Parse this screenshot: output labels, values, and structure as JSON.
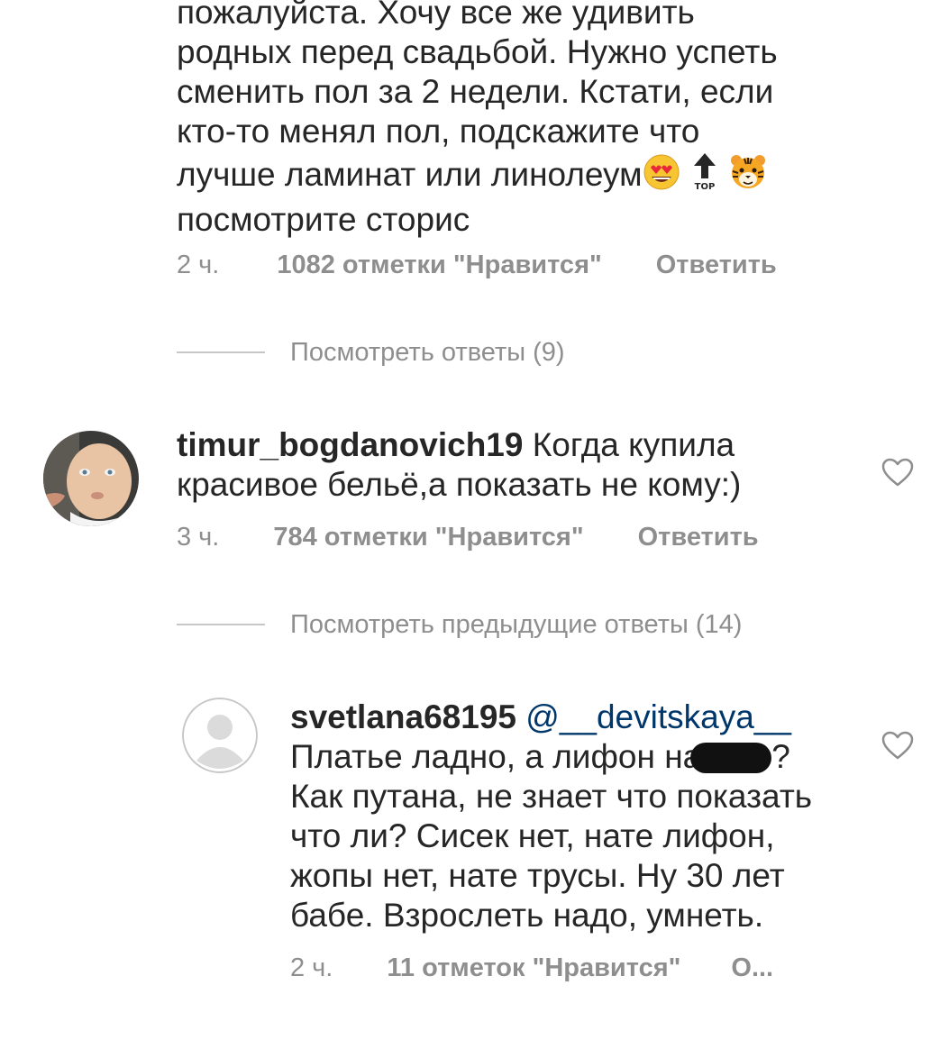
{
  "comment1": {
    "text_before_emoji": "пожалуйста. Хочу все же удивить\nродных перед свадьбой. Нужно успеть\nсменить пол за 2 недели. Кстати, если\nкто-то менял пол, подскажите что\nлучше ламинат или линолеум",
    "text_after_emoji": "посмотрите сторис",
    "emojis": [
      "heart-eyes-emoji",
      "top-arrow-emoji",
      "tiger-face-emoji"
    ],
    "top_label": "TOP",
    "time": "2 ч.",
    "likes": "1082 отметки \"Нравится\"",
    "reply": "Ответить"
  },
  "view_replies_1": {
    "label": "Посмотреть ответы (9)"
  },
  "comment2": {
    "username": "timur_bogdanovich19",
    "text": " Когда купила\nкрасивое бельё,а показать не кому:)",
    "time": "3 ч.",
    "likes": "784 отметки \"Нравится\"",
    "reply": "Ответить"
  },
  "view_replies_2": {
    "label": "Посмотреть предыдущие ответы (14)"
  },
  "comment3": {
    "username": "svetlana68195",
    "mention": " @__devitskaya__",
    "text_line1_before": "Платье ладно, а лифон на",
    "text_line1_after": "?",
    "text_rest": "Как путана, не знает что показать\nчто ли? Сисек нет, нате лифон,\nжопы нет, нате трусы. Ну 30 лет\nбабе. Взрослеть надо, умнеть.",
    "time": "2 ч.",
    "likes": "11 отметок \"Нравится\"",
    "reply": "О..."
  },
  "colors": {
    "text": "#262626",
    "meta": "#8e8e8e",
    "mention": "#00376b",
    "divider": "#c7c7c7"
  }
}
